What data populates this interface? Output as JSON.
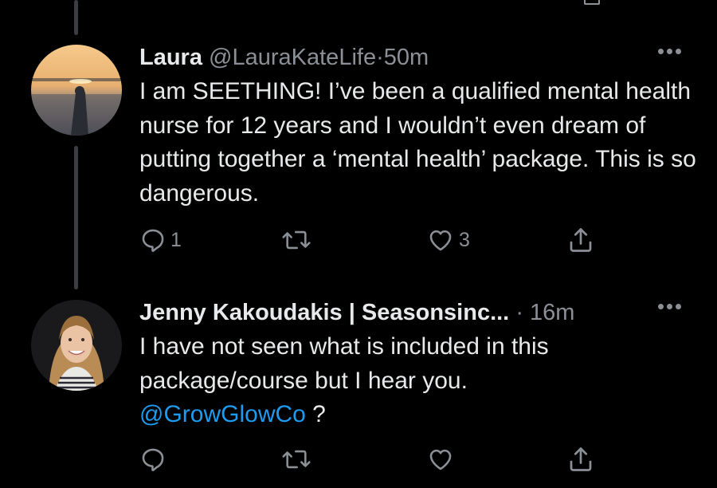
{
  "replies": [
    {
      "display_name": "Laura",
      "handle": "@LauraKateLife",
      "separator": "·",
      "time": "50m",
      "text": "I am SEETHING! I’ve been a qualified mental health nurse for 12 years and I wouldn’t even dream of putting together a ‘mental health’ package. This is so dangerous.",
      "reply_count": "1",
      "retweet_count": "",
      "like_count": "3"
    },
    {
      "display_name": "Jenny Kakoudakis | Seasonsinc...",
      "separator": "·",
      "time": "16m",
      "text": "I have not seen what is included in this package/course but I hear you.",
      "mention": "@GrowGlowCo",
      "text_after_mention": " ?",
      "reply_count": "",
      "retweet_count": "",
      "like_count": ""
    }
  ],
  "icons": {
    "reply": "reply-icon",
    "retweet": "retweet-icon",
    "like": "heart-icon",
    "share": "share-icon",
    "more": "more-options-icon"
  },
  "colors": {
    "background": "#000000",
    "text": "#e7e9ea",
    "secondary": "#8b9097",
    "link": "#1d9bf0",
    "thread_line": "#3a3d41"
  }
}
